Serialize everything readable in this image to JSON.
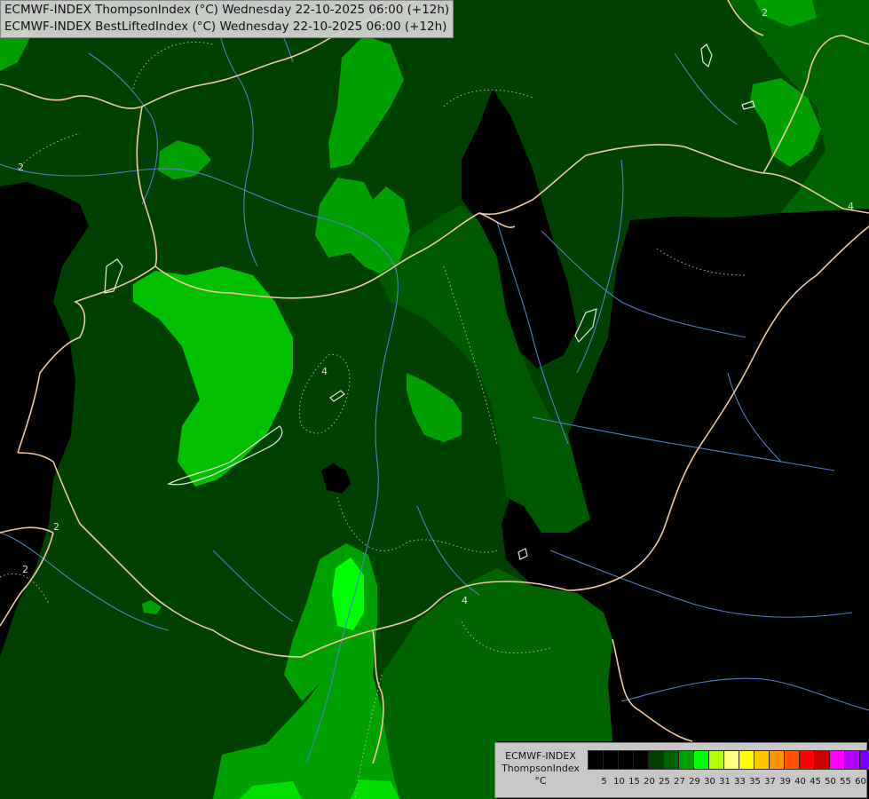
{
  "title": {
    "line1": "ECMWF-INDEX ThompsonIndex (°C) Wednesday 22-10-2025 06:00 (+12h)",
    "line2": "ECMWF-INDEX BestLiftedIndex (°C) Wednesday 22-10-2025 06:00 (+12h)"
  },
  "legend": {
    "model": "ECMWF-INDEX",
    "parameter": "ThompsonIndex",
    "unit": "°C",
    "thresholds": [
      "5",
      "10",
      "15",
      "20",
      "25",
      "27",
      "29",
      "30",
      "31",
      "33",
      "35",
      "37",
      "39",
      "40",
      "45",
      "50",
      "55",
      "60"
    ],
    "colors": [
      "#000000",
      "#000000",
      "#000000",
      "#000000",
      "#004000",
      "#006400",
      "#00a000",
      "#00ff00",
      "#b4ff00",
      "#ffff80",
      "#ffff00",
      "#ffc800",
      "#ff9600",
      "#ff5000",
      "#ff0000",
      "#c80000",
      "#ff00ff",
      "#b400ff",
      "#7800ff",
      "#0000ff"
    ]
  },
  "contour_labels": [
    "2",
    "2",
    "2",
    "2",
    "4",
    "4",
    "4"
  ],
  "colors": {
    "background": "#000000",
    "field_dark": "#004000",
    "field_mid": "#006400",
    "field_light": "#00a000",
    "field_bright": "#00ff00",
    "borders": "#f0c8a0",
    "rivers": "#5080c8",
    "contours": "#c8c8c8"
  }
}
